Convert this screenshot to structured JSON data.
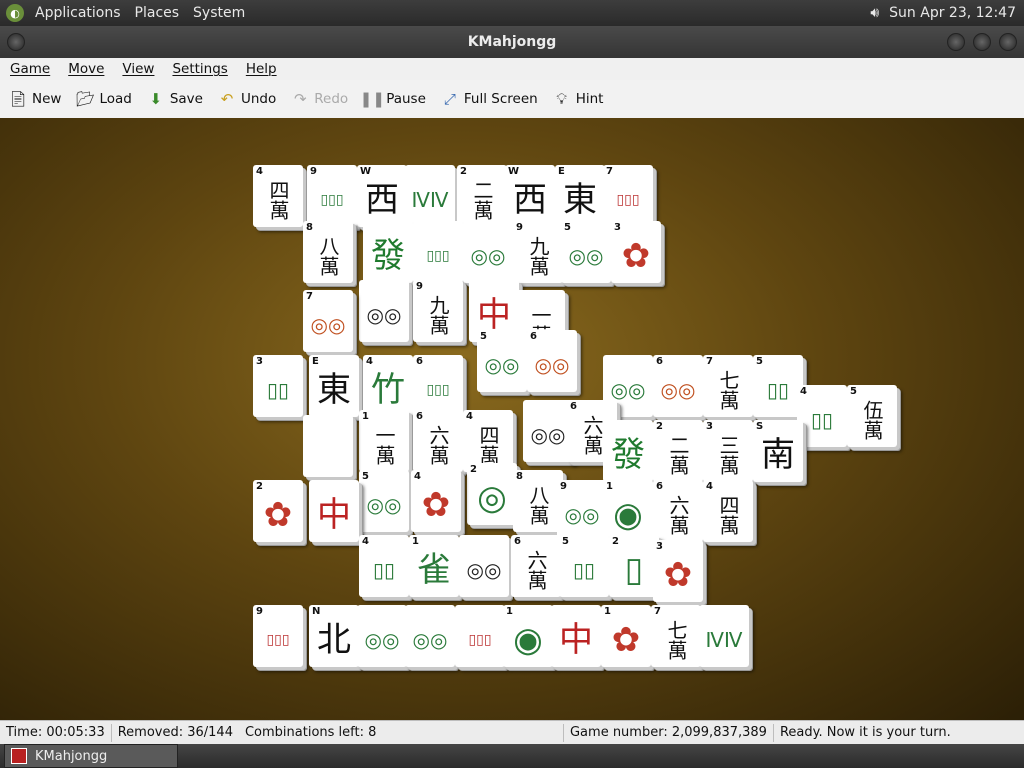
{
  "top_panel": {
    "menus": [
      "Applications",
      "Places",
      "System"
    ],
    "clock": "Sun Apr 23, 12:47"
  },
  "window": {
    "title": "KMahjongg"
  },
  "menubar": [
    "Game",
    "Move",
    "View",
    "Settings",
    "Help"
  ],
  "toolbar": {
    "new": "New",
    "load": "Load",
    "save": "Save",
    "undo": "Undo",
    "redo": "Redo",
    "pause": "Pause",
    "full_screen": "Full Screen",
    "hint": "Hint"
  },
  "tiles": [
    {
      "n": "4",
      "g": "四萬",
      "c": "#111"
    },
    {
      "n": "9",
      "g": "▯▯▯",
      "c": "#2a7a3a"
    },
    {
      "n": "W",
      "g": "西",
      "c": "#111"
    },
    {
      "n": "",
      "g": "ⅣⅣ",
      "c": "#2a7a3a"
    },
    {
      "n": "2",
      "g": "二萬",
      "c": "#111"
    },
    {
      "n": "W",
      "g": "西",
      "c": "#111"
    },
    {
      "n": "E",
      "g": "東",
      "c": "#111"
    },
    {
      "n": "7",
      "g": "▯▯▯",
      "c": "#b33"
    },
    {
      "n": "8",
      "g": "八萬",
      "c": "#111"
    },
    {
      "n": "",
      "g": "發",
      "c": "#1f7a2e"
    },
    {
      "n": "",
      "g": "▯▯▯",
      "c": "#2a7a3a"
    },
    {
      "n": "",
      "g": "◎◎",
      "c": "#2a7a3a"
    },
    {
      "n": "9",
      "g": "九萬",
      "c": "#111"
    },
    {
      "n": "5",
      "g": "◎◎",
      "c": "#2a7a3a"
    },
    {
      "n": "3",
      "g": "✿",
      "c": "#c0392b"
    },
    {
      "n": "7",
      "g": "◎◎",
      "c": "#c05020"
    },
    {
      "n": "",
      "g": "◎◎",
      "c": "#222"
    },
    {
      "n": "9",
      "g": "九萬",
      "c": "#111"
    },
    {
      "n": "",
      "g": "中",
      "c": "#b22"
    },
    {
      "n": "",
      "g": "一萬",
      "c": "#111"
    },
    {
      "n": "5",
      "g": "◎◎",
      "c": "#2a7a3a"
    },
    {
      "n": "6",
      "g": "◎◎",
      "c": "#c05020"
    },
    {
      "n": "",
      "g": "◎◎",
      "c": "#2a7a3a"
    },
    {
      "n": "6",
      "g": "◎◎",
      "c": "#c05020"
    },
    {
      "n": "7",
      "g": "七萬",
      "c": "#111"
    },
    {
      "n": "5",
      "g": "▯▯",
      "c": "#2a7a3a"
    },
    {
      "n": "3",
      "g": "▯▯",
      "c": "#2a7a3a"
    },
    {
      "n": "E",
      "g": "東",
      "c": "#111"
    },
    {
      "n": "4",
      "g": "竹",
      "c": "#2a7a3a"
    },
    {
      "n": "6",
      "g": "▯▯▯",
      "c": "#2a7a3a"
    },
    {
      "n": "4",
      "g": "▯▯",
      "c": "#2a7a3a"
    },
    {
      "n": "5",
      "g": "伍萬",
      "c": "#111"
    },
    {
      "n": "",
      "g": "",
      "c": "#111"
    },
    {
      "n": "1",
      "g": "一萬",
      "c": "#111"
    },
    {
      "n": "6",
      "g": "六萬",
      "c": "#111"
    },
    {
      "n": "4",
      "g": "四萬",
      "c": "#111"
    },
    {
      "n": "",
      "g": "◎◎",
      "c": "#222"
    },
    {
      "n": "6",
      "g": "六萬",
      "c": "#111"
    },
    {
      "n": "",
      "g": "發",
      "c": "#1f7a2e"
    },
    {
      "n": "2",
      "g": "二萬",
      "c": "#111"
    },
    {
      "n": "3",
      "g": "三萬",
      "c": "#111"
    },
    {
      "n": "S",
      "g": "南",
      "c": "#111"
    },
    {
      "n": "2",
      "g": "✿",
      "c": "#c0392b"
    },
    {
      "n": "",
      "g": "中",
      "c": "#b22"
    },
    {
      "n": "5",
      "g": "◎◎",
      "c": "#2a7a3a"
    },
    {
      "n": "4",
      "g": "✿",
      "c": "#c0392b"
    },
    {
      "n": "2",
      "g": "◎",
      "c": "#2a7a3a"
    },
    {
      "n": "8",
      "g": "八萬",
      "c": "#111"
    },
    {
      "n": "9",
      "g": "◎◎",
      "c": "#2a7a3a"
    },
    {
      "n": "1",
      "g": "◉",
      "c": "#2a7a3a"
    },
    {
      "n": "6",
      "g": "六萬",
      "c": "#111"
    },
    {
      "n": "4",
      "g": "四萬",
      "c": "#111"
    },
    {
      "n": "4",
      "g": "▯▯",
      "c": "#2a7a3a"
    },
    {
      "n": "1",
      "g": "雀",
      "c": "#2a7a3a"
    },
    {
      "n": "",
      "g": "◎◎",
      "c": "#222"
    },
    {
      "n": "6",
      "g": "六萬",
      "c": "#111"
    },
    {
      "n": "5",
      "g": "▯▯",
      "c": "#2a7a3a"
    },
    {
      "n": "2",
      "g": "▯",
      "c": "#2a7a3a"
    },
    {
      "n": "3",
      "g": "✿",
      "c": "#c0392b"
    },
    {
      "n": "9",
      "g": "▯▯▯",
      "c": "#b33"
    },
    {
      "n": "N",
      "g": "北",
      "c": "#111"
    },
    {
      "n": "",
      "g": "◎◎",
      "c": "#2a7a3a"
    },
    {
      "n": "",
      "g": "◎◎",
      "c": "#2a7a3a"
    },
    {
      "n": "",
      "g": "▯▯▯",
      "c": "#b33"
    },
    {
      "n": "1",
      "g": "◉",
      "c": "#2a7a3a"
    },
    {
      "n": "",
      "g": "中",
      "c": "#b22"
    },
    {
      "n": "1",
      "g": "✿",
      "c": "#c0392b"
    },
    {
      "n": "7",
      "g": "七萬",
      "c": "#111"
    },
    {
      "n": "",
      "g": "ⅣⅣ",
      "c": "#2a7a3a"
    }
  ],
  "status": {
    "time": "Time: 00:05:33",
    "removed": "Removed: 36/144",
    "combinations": "Combinations left: 8",
    "game_number": "Game number: 2,099,837,389",
    "message": "Ready. Now it is your turn."
  },
  "taskbar": {
    "app": "KMahjongg"
  }
}
